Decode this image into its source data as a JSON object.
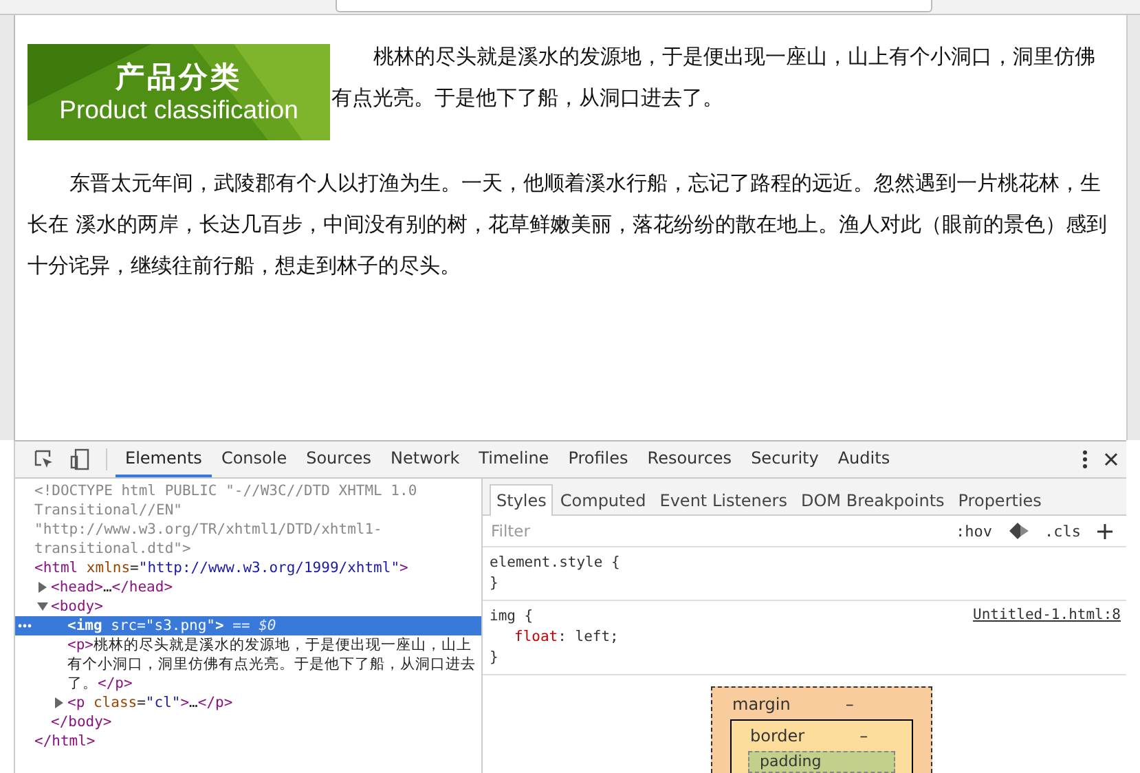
{
  "page": {
    "banner": {
      "title": "产品分类",
      "subtitle": "Product classification"
    },
    "paragraphs": [
      "桃林的尽头就是溪水的发源地，于是便出现一座山，山上有个小洞口，洞里仿佛有点光亮。于是他下了船，从洞口进去了。",
      "东晋太元年间，武陵郡有个人以打渔为生。一天，他顺着溪水行船，忘记了路程的远近。忽然遇到一片桃花林，生长在 溪水的两岸，长达几百步，中间没有别的树，花草鲜嫩美丽，落花纷纷的散在地上。渔人对此（眼前的景色）感到十分诧异，继续往前行船，想走到林子的尽头。"
    ]
  },
  "devtools": {
    "tabs": [
      {
        "label": "Elements",
        "selected": true
      },
      {
        "label": "Console",
        "selected": false
      },
      {
        "label": "Sources",
        "selected": false
      },
      {
        "label": "Network",
        "selected": false
      },
      {
        "label": "Timeline",
        "selected": false
      },
      {
        "label": "Profiles",
        "selected": false
      },
      {
        "label": "Resources",
        "selected": false
      },
      {
        "label": "Security",
        "selected": false
      },
      {
        "label": "Audits",
        "selected": false
      }
    ],
    "dom_tree": [
      {
        "selected": false,
        "parts": [
          {
            "kind": "comment",
            "text": "<!DOCTYPE html PUBLIC \"-//W3C//DTD XHTML 1.0 Transitional//EN\" \"http://www.w3.org/TR/xhtml1/DTD/xhtml1-transitional.dtd\">"
          }
        ]
      },
      {
        "selected": false,
        "parts": [
          {
            "kind": "tag",
            "text": "<html"
          },
          {
            "kind": "attr",
            "text": " xmlns"
          },
          {
            "kind": "punct",
            "text": "="
          },
          {
            "kind": "value",
            "text": "\"http://www.w3.org/1999/xhtml\""
          },
          {
            "kind": "tag",
            "text": ">"
          }
        ],
        "closing": "</html>",
        "children": [
          {
            "selected": false,
            "expanded": false,
            "parts": [
              {
                "kind": "tag",
                "text": "<head>"
              },
              {
                "kind": "text",
                "text": "…"
              },
              {
                "kind": "tag",
                "text": "</head>"
              }
            ]
          },
          {
            "selected": false,
            "expanded": true,
            "parts": [
              {
                "kind": "tag",
                "text": "<body>"
              }
            ],
            "closing": "</body>",
            "children": [
              {
                "selected": true,
                "parts": [
                  {
                    "kind": "tag",
                    "text": "<img"
                  },
                  {
                    "kind": "attr",
                    "text": " src"
                  },
                  {
                    "kind": "punct",
                    "text": "="
                  },
                  {
                    "kind": "value",
                    "text": "\"s3.png\""
                  },
                  {
                    "kind": "tag",
                    "text": ">"
                  },
                  {
                    "kind": "ref",
                    "text": " == $0"
                  }
                ]
              },
              {
                "selected": false,
                "parts": [
                  {
                    "kind": "tag",
                    "text": "<p>"
                  },
                  {
                    "kind": "text",
                    "text": "桃林的尽头就是溪水的发源地，于是便出现一座山，山上有个小洞口，洞里仿佛有点光亮。于是他下了船，从洞口进去了。"
                  },
                  {
                    "kind": "tag",
                    "text": "</p>"
                  }
                ]
              },
              {
                "selected": false,
                "expanded": false,
                "parts": [
                  {
                    "kind": "tag",
                    "text": "<p"
                  },
                  {
                    "kind": "attr",
                    "text": " class"
                  },
                  {
                    "kind": "punct",
                    "text": "="
                  },
                  {
                    "kind": "value",
                    "text": "\"cl\""
                  },
                  {
                    "kind": "tag",
                    "text": ">"
                  },
                  {
                    "kind": "text",
                    "text": "…"
                  },
                  {
                    "kind": "tag",
                    "text": "</p>"
                  }
                ]
              }
            ]
          }
        ]
      }
    ],
    "style_tabs": [
      {
        "label": "Styles",
        "selected": true
      },
      {
        "label": "Computed",
        "selected": false
      },
      {
        "label": "Event Listeners",
        "selected": false
      },
      {
        "label": "DOM Breakpoints",
        "selected": false
      },
      {
        "label": "Properties",
        "selected": false
      }
    ],
    "filter": {
      "placeholder": "Filter",
      "hov": ":hov",
      "cls": ".cls"
    },
    "rules": [
      {
        "selector": "element.style {",
        "close": "}"
      },
      {
        "selector": "img {",
        "source": "Untitled-1.html:8",
        "declarations": [
          {
            "property": "float",
            "separator": ": ",
            "value": "left;"
          }
        ],
        "close": "}"
      }
    ],
    "box_model": {
      "margin": {
        "label": "margin",
        "value": "–"
      },
      "border": {
        "label": "border",
        "value": "–"
      },
      "padding": {
        "label": "padding"
      }
    }
  }
}
